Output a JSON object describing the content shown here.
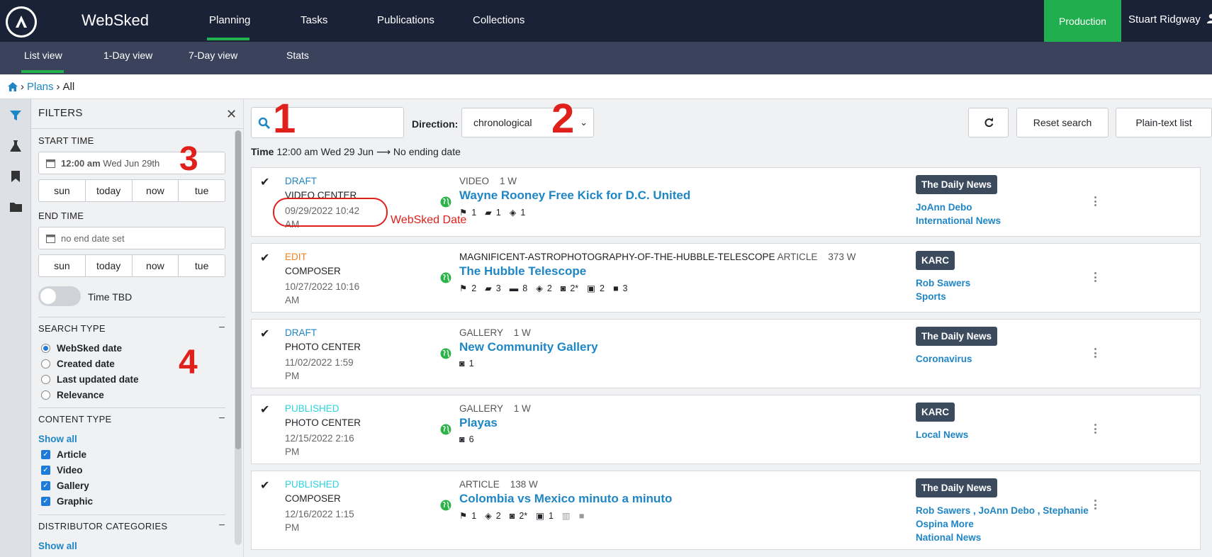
{
  "topnav": {
    "app_name": "WebSked",
    "tabs": [
      "Planning",
      "Tasks",
      "Publications",
      "Collections"
    ],
    "environment": "Production",
    "user_name": "Stuart Ridgway"
  },
  "subnav": {
    "tabs": [
      "List view",
      "1-Day view",
      "7-Day view",
      "Stats"
    ]
  },
  "breadcrumb": {
    "plans": "Plans",
    "current": "All"
  },
  "filters": {
    "title": "FILTERS",
    "start_time": {
      "label": "START TIME",
      "value_time": "12:00 am",
      "value_date": "Wed Jun 29th",
      "quick": [
        "sun",
        "today",
        "now",
        "tue"
      ]
    },
    "end_time": {
      "label": "END TIME",
      "placeholder": "no end date set",
      "quick": [
        "sun",
        "today",
        "now",
        "tue"
      ]
    },
    "time_tbd_label": "Time TBD",
    "search_type": {
      "label": "SEARCH TYPE",
      "options": [
        "WebSked date",
        "Created date",
        "Last updated date",
        "Relevance"
      ],
      "selected": "WebSked date"
    },
    "content_type": {
      "label": "CONTENT TYPE",
      "show_all": "Show all",
      "options": [
        "Article",
        "Video",
        "Gallery",
        "Graphic"
      ]
    },
    "distributor": {
      "label": "DISTRIBUTOR CATEGORIES",
      "show_all": "Show all"
    }
  },
  "toolbar": {
    "search_placeholder": "",
    "direction_label": "Direction:",
    "direction_value": "chronological",
    "reset_label": "Reset search",
    "plaintext_label": "Plain-text list"
  },
  "timeline": {
    "label": "Time",
    "start": "12:00 am Wed 29 Jun",
    "end": "No ending date"
  },
  "annotations": {
    "n1": "1",
    "n2": "2",
    "n3": "3",
    "n4": "4",
    "websked_date": "WebSked Date"
  },
  "colors": {
    "draft": "#1f86c6",
    "edit": "#f58220",
    "published": "#2ed3dd",
    "accent": "#21ae4e",
    "nav": "#1a2238"
  },
  "cards": [
    {
      "status": "DRAFT",
      "status_color": "#1f86c6",
      "desk": "VIDEO CENTER",
      "date_line1": "09/29/2022 10:42",
      "date_line2": "AM",
      "type_line": "VIDEO    1 W",
      "title": "Wayne Rooney Free Kick for D.C. United",
      "meta": [
        {
          "icon": "flag-icon",
          "count": "1"
        },
        {
          "icon": "book-icon",
          "count": "1"
        },
        {
          "icon": "tag-icon",
          "count": "1"
        }
      ],
      "org": "The Daily News",
      "people": [
        "JoAnn Debo",
        "International News"
      ]
    },
    {
      "status": "EDIT",
      "status_color": "#f58220",
      "desk": "COMPOSER",
      "date_line1": "10/27/2022 10:16",
      "date_line2": "AM",
      "type_slug": "MAGNIFICENT-ASTROPHOTOGRAPHY-OF-THE-HUBBLE-TELESCOPE",
      "type_line": "ARTICLE    373 W",
      "title": "The Hubble Telescope",
      "meta": [
        {
          "icon": "flag-icon",
          "count": "2"
        },
        {
          "icon": "book-icon",
          "count": "3"
        },
        {
          "icon": "folder-icon",
          "count": "8"
        },
        {
          "icon": "tag-icon",
          "count": "2"
        },
        {
          "icon": "camera-icon",
          "count": "2*"
        },
        {
          "icon": "image-icon",
          "count": "2"
        },
        {
          "icon": "video-icon",
          "count": "3"
        }
      ],
      "org": "KARC",
      "people": [
        "Rob Sawers",
        "Sports"
      ]
    },
    {
      "status": "DRAFT",
      "status_color": "#1f86c6",
      "desk": "PHOTO CENTER",
      "date_line1": "11/02/2022 1:59",
      "date_line2": "PM",
      "type_line": "GALLERY    1 W",
      "title": "New Community Gallery",
      "meta": [
        {
          "icon": "camera-icon",
          "count": "1"
        }
      ],
      "org": "The Daily News",
      "people": [
        "Coronavirus"
      ]
    },
    {
      "status": "PUBLISHED",
      "status_color": "#2ed3dd",
      "desk": "PHOTO CENTER",
      "date_line1": "12/15/2022 2:16",
      "date_line2": "PM",
      "type_line": "GALLERY    1 W",
      "title": "Playas",
      "meta": [
        {
          "icon": "camera-icon",
          "count": "6"
        }
      ],
      "org": "KARC",
      "people": [
        "Local News"
      ]
    },
    {
      "status": "PUBLISHED",
      "status_color": "#2ed3dd",
      "desk": "COMPOSER",
      "date_line1": "12/16/2022 1:15",
      "date_line2": "PM",
      "type_line": "ARTICLE    138 W",
      "title": "Colombia vs Mexico minuto a minuto",
      "meta": [
        {
          "icon": "flag-icon",
          "count": "1"
        },
        {
          "icon": "tag-icon",
          "count": "2"
        },
        {
          "icon": "camera-icon",
          "count": "2*"
        },
        {
          "icon": "image-icon",
          "count": "1"
        },
        {
          "icon": "chart-icon",
          "count": ""
        },
        {
          "icon": "video-icon",
          "count": ""
        }
      ],
      "org": "The Daily News",
      "people": [
        "Rob Sawers , JoAnn Debo , Stephanie Ospina More",
        "National News"
      ]
    }
  ]
}
